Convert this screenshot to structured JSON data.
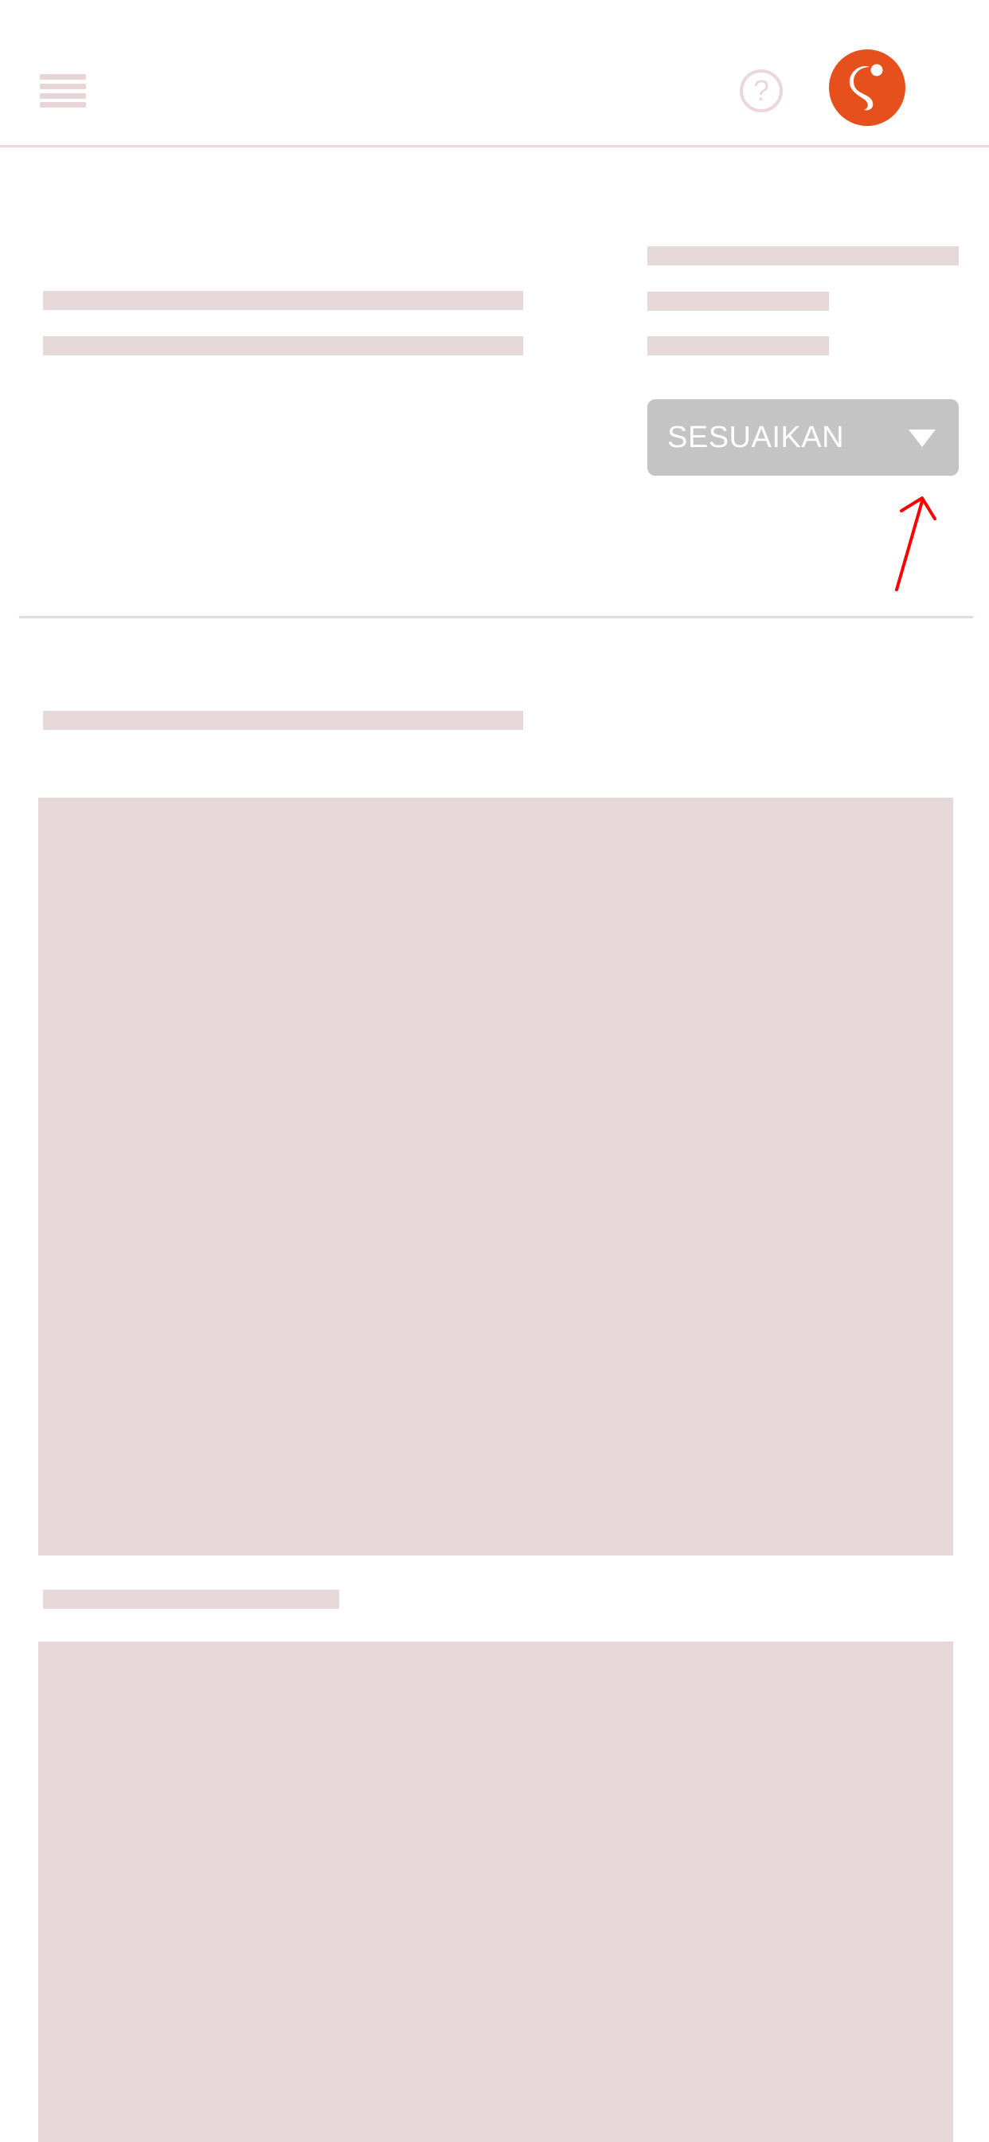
{
  "header": {
    "menu_icon": "hamburger-menu-icon",
    "help_icon": "question-mark-icon",
    "help_glyph": "?",
    "logo_icon": "duolingo-style-logo-icon"
  },
  "filter": {
    "label": "SESUAIKAN",
    "caret_icon": "triangle-down-icon"
  },
  "colors": {
    "skeleton": "#e6d7d8",
    "button_bg": "#c4c4c4",
    "logo_orange": "#e5501c",
    "annotation_red": "#ff0000"
  }
}
